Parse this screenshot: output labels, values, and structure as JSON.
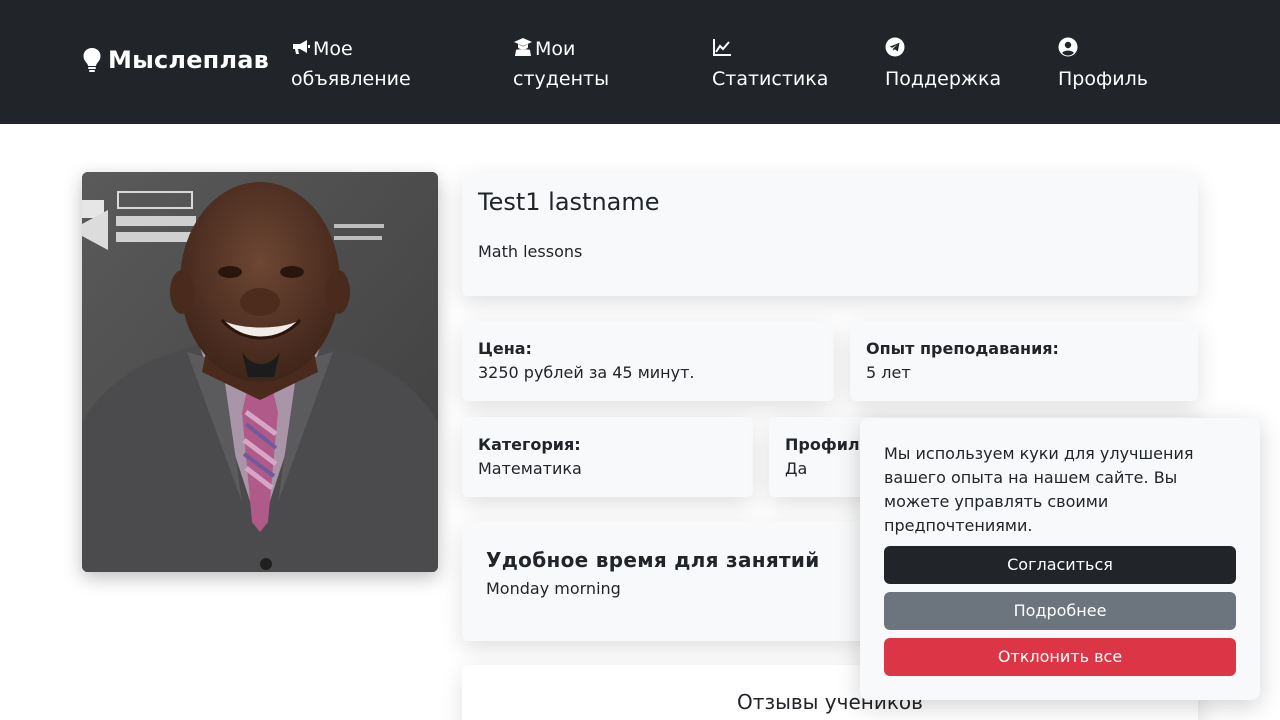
{
  "navbar": {
    "brand": "Мыслеплав",
    "items": [
      {
        "icon": "megaphone-icon",
        "line1": "Мое",
        "line2": "объявление"
      },
      {
        "icon": "graduate-icon",
        "line1": "Мои",
        "line2": "студенты"
      },
      {
        "icon": "chart-line-icon",
        "line1": "",
        "line2": "Статистика"
      },
      {
        "icon": "telegram-icon",
        "line1": "",
        "line2": "Поддержка"
      },
      {
        "icon": "user-circle-icon",
        "line1": "",
        "line2": "Профиль"
      }
    ]
  },
  "profile": {
    "name": "Test1 lastname",
    "description": "Math lessons",
    "price_label": "Цена:",
    "price_value": "3250 рублей за 45 минут.",
    "experience_label": "Опыт преподавания:",
    "experience_value": "5 лет",
    "category_label": "Категория:",
    "category_value": "Математика",
    "profile_label": "Профил",
    "profile_value": "Да",
    "schedule_title": "Удобное время для занятий",
    "schedule_value": "Monday morning",
    "reviews_title": "Отзывы учеников"
  },
  "cookie": {
    "message": "Мы используем куки для улучшения вашего опыта на нашем сайте. Вы можете управлять своими предпочтениями.",
    "accept": "Согласиться",
    "more": "Подробнее",
    "reject": "Отклонить все"
  },
  "colors": {
    "navbar": "#212529",
    "card": "#f8f9fa",
    "accept": "#212529",
    "more": "#6c757d",
    "reject": "#dc3545"
  }
}
